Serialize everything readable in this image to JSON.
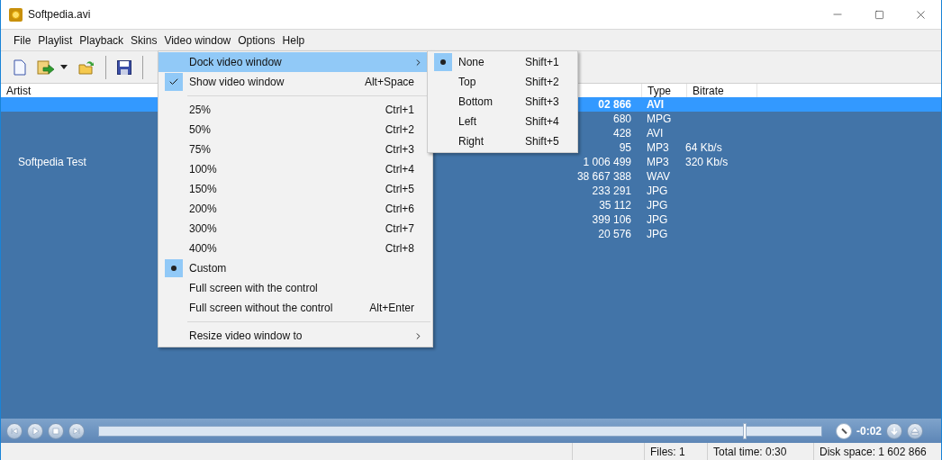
{
  "window": {
    "title": "Softpedia.avi"
  },
  "menu_bar": [
    {
      "label": "File"
    },
    {
      "label": "Playlist"
    },
    {
      "label": "Playback"
    },
    {
      "label": "Skins"
    },
    {
      "label": "Video window"
    },
    {
      "label": "Options"
    },
    {
      "label": "Help"
    }
  ],
  "playlist": {
    "columns": [
      {
        "label": "Artist",
        "kind": "artist"
      },
      {
        "kind": "size"
      },
      {
        "label": "Type",
        "kind": "type"
      },
      {
        "label": "Bitrate",
        "kind": "bitrate"
      }
    ],
    "rows": [
      {
        "size": "02 866",
        "type": "AVI",
        "selected": true,
        "playing": true
      },
      {
        "size": "680",
        "type": "MPG",
        "selected": false,
        "playing": false
      },
      {
        "size": "428",
        "type": "AVI",
        "selected": false,
        "playing": false
      },
      {
        "size": "95",
        "type": "MP3",
        "bitrate": "64 Kb/s",
        "selected": false,
        "playing": false
      },
      {
        "artist": "Softpedia Test",
        "size": "1 006 499",
        "type": "MP3",
        "bitrate": "320 Kb/s",
        "selected": false,
        "playing": false
      },
      {
        "size": "38 667 388",
        "type": "WAV",
        "selected": false,
        "playing": false
      },
      {
        "size": "233 291",
        "type": "JPG",
        "selected": false,
        "playing": false
      },
      {
        "size": "35 112",
        "type": "JPG",
        "selected": false,
        "playing": false
      },
      {
        "size": "399 106",
        "type": "JPG",
        "selected": false,
        "playing": false
      },
      {
        "size": "20 576",
        "type": "JPG",
        "selected": false,
        "playing": false
      }
    ]
  },
  "video_window_menu": [
    {
      "kind": "submenu",
      "label": "Dock video window",
      "highlighted": true
    },
    {
      "kind": "check",
      "label": "Show video window",
      "shortcut": "Alt+Space",
      "checked": true,
      "highlighted": false
    },
    {
      "kind": "separator"
    },
    {
      "kind": "radio",
      "label": "25%",
      "shortcut": "Ctrl+1",
      "checked": false,
      "highlighted": false
    },
    {
      "kind": "radio",
      "label": "50%",
      "shortcut": "Ctrl+2",
      "checked": false,
      "highlighted": false
    },
    {
      "kind": "radio",
      "label": "75%",
      "shortcut": "Ctrl+3",
      "checked": false,
      "highlighted": false
    },
    {
      "kind": "radio",
      "label": "100%",
      "shortcut": "Ctrl+4",
      "checked": false,
      "highlighted": false
    },
    {
      "kind": "radio",
      "label": "150%",
      "shortcut": "Ctrl+5",
      "checked": false,
      "highlighted": false
    },
    {
      "kind": "radio",
      "label": "200%",
      "shortcut": "Ctrl+6",
      "checked": false,
      "highlighted": false
    },
    {
      "kind": "radio",
      "label": "300%",
      "shortcut": "Ctrl+7",
      "checked": false,
      "highlighted": false
    },
    {
      "kind": "radio",
      "label": "400%",
      "shortcut": "Ctrl+8",
      "checked": false,
      "highlighted": false
    },
    {
      "kind": "radio",
      "label": "Custom",
      "checked": true,
      "highlighted": false
    },
    {
      "kind": "radio",
      "label": "Full screen with the control",
      "checked": false,
      "highlighted": false
    },
    {
      "kind": "radio",
      "label": "Full screen without the control",
      "shortcut": "Alt+Enter",
      "checked": false,
      "highlighted": false
    },
    {
      "kind": "separator"
    },
    {
      "kind": "submenu",
      "label": "Resize video window to",
      "highlighted": false
    }
  ],
  "dock_submenu": [
    {
      "label": "None",
      "shortcut": "Shift+1",
      "checked": true
    },
    {
      "label": "Top",
      "shortcut": "Shift+2",
      "checked": false
    },
    {
      "label": "Bottom",
      "shortcut": "Shift+3",
      "checked": false
    },
    {
      "label": "Left",
      "shortcut": "Shift+4",
      "checked": false
    },
    {
      "label": "Right",
      "shortcut": "Shift+5",
      "checked": false
    }
  ],
  "player": {
    "level": 0.894,
    "time": "-0:02"
  },
  "status_bar": [
    "Files: 1",
    "Total time: 0:30",
    "Disk space: 1 602 866"
  ]
}
